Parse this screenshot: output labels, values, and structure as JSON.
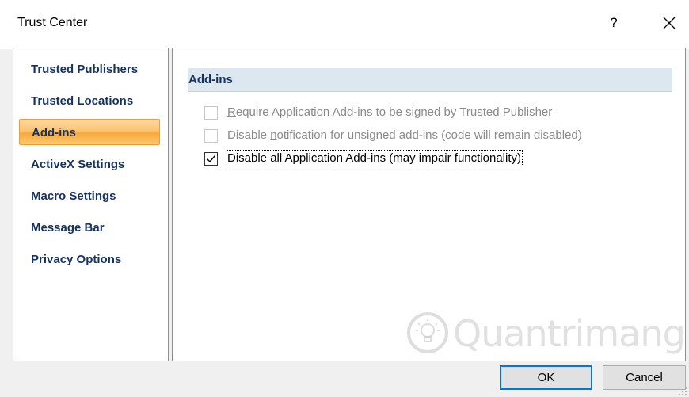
{
  "window": {
    "title": "Trust Center",
    "help_label": "?",
    "close_icon": "close-icon"
  },
  "sidebar": {
    "items": [
      {
        "label": "Trusted Publishers",
        "active": false
      },
      {
        "label": "Trusted Locations",
        "active": false
      },
      {
        "label": "Add-ins",
        "active": true
      },
      {
        "label": "ActiveX Settings",
        "active": false
      },
      {
        "label": "Macro Settings",
        "active": false
      },
      {
        "label": "Message Bar",
        "active": false
      },
      {
        "label": "Privacy Options",
        "active": false
      }
    ]
  },
  "main": {
    "section_title": "Add-ins",
    "options": [
      {
        "pre": "",
        "u": "R",
        "post": "equire Application Add-ins to be signed by Trusted Publisher",
        "checked": false,
        "enabled": false
      },
      {
        "pre": "Disable ",
        "u": "n",
        "post": "otification for unsigned add-ins (code will remain disabled)",
        "checked": false,
        "enabled": false
      },
      {
        "pre": "Disable all Application Add-ins (may impair functionality)",
        "u": "",
        "post": "",
        "checked": true,
        "enabled": true
      }
    ]
  },
  "footer": {
    "ok_label": "OK",
    "cancel_label": "Cancel"
  },
  "watermark": {
    "text": "Quantrimang"
  },
  "colors": {
    "nav_text": "#15325f",
    "active_item": "#fbc36f",
    "section_header_bg": "#dde7f0",
    "default_button_border": "#0078d7"
  }
}
